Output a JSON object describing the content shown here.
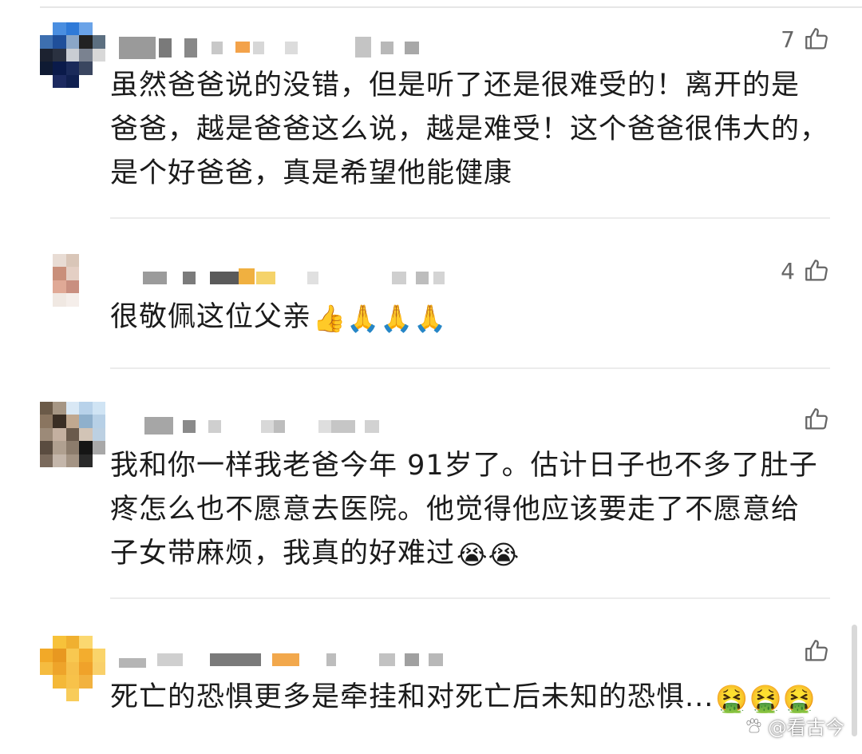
{
  "comments": [
    {
      "likes": "7",
      "lines": [
        "虽然爸爸说的没错，但是听了还是很难受的！离开的是",
        "爸爸，越是爸爸这么说，越是难受！这个爸爸很伟大的，",
        "是个好爸爸，真是希望他能健康"
      ],
      "emoji": ""
    },
    {
      "likes": "4",
      "lines": [
        "很敬佩这位父亲"
      ],
      "emoji": "👍🙏🙏🙏"
    },
    {
      "likes": "",
      "lines": [
        "我和你一样我老爸今年 91岁了。估计日子也不多了肚子",
        "疼怎么也不愿意去医院。他觉得他应该要走了不愿意给",
        "子女带麻烦，我真的好难过"
      ],
      "emoji": "😭😭"
    },
    {
      "likes": "",
      "lines": [
        "死亡的恐惧更多是牵挂和对死亡后未知的恐惧..."
      ],
      "emoji": "🤮🤮🤮"
    }
  ],
  "like_icon": "thumbs-up-outline-icon",
  "watermark": {
    "icon": "paw-icon",
    "text": "@看古今"
  },
  "colors": {
    "text": "#1b1b1b",
    "likes": "#666666",
    "divider": "#ececec"
  }
}
